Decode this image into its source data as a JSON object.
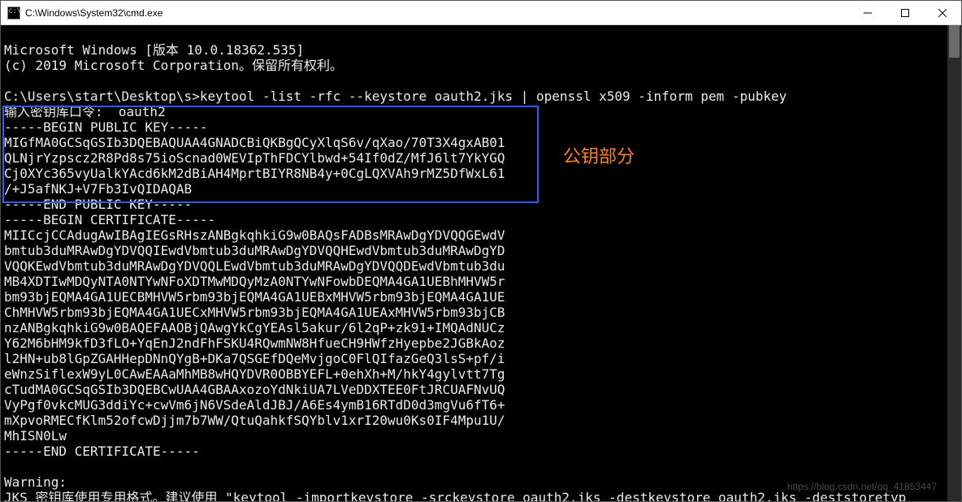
{
  "window": {
    "title": "C:\\Windows\\System32\\cmd.exe"
  },
  "terminal": {
    "header1": "Microsoft Windows [版本 10.0.18362.535]",
    "header2": "(c) 2019 Microsoft Corporation。保留所有权利。",
    "prompt_line": "C:\\Users\\start\\Desktop\\s>keytool -list -rfc --keystore oauth2.jks | openssl x509 -inform pem -pubkey",
    "password_line": "输入密钥库口令:  oauth2",
    "pubkey_begin": "-----BEGIN PUBLIC KEY-----",
    "pubkey_l1": "MIGfMA0GCSqGSIb3DQEBAQUAA4GNADCBiQKBgQCyXlqS6v/qXao/70T3X4gxAB01",
    "pubkey_l2": "QLNjrYzpscz2R8Pd8s75ioScnad0WEVIpThFDCYlbwd+54If0dZ/MfJ6lt7YkYGQ",
    "pubkey_l3": "Cj0XYc365vyUalkYAcd6kM2dBiAH4MprtBIYR8NB4y+0CgLQXVAh9rMZ5DfWxL61",
    "pubkey_l4": "/+J5afNKJ+V7Fb3IvQIDAQAB",
    "pubkey_end": "-----END PUBLIC KEY-----",
    "cert_begin": "-----BEGIN CERTIFICATE-----",
    "cert_l1": "MIICcjCCAdugAwIBAgIEGsRHszANBgkqhkiG9w0BAQsFADBsMRAwDgYDVQQGEwdV",
    "cert_l2": "bmtub3duMRAwDgYDVQQIEwdVbmtub3duMRAwDgYDVQQHEwdVbmtub3duMRAwDgYD",
    "cert_l3": "VQQKEwdVbmtub3duMRAwDgYDVQQLEwdVbmtub3duMRAwDgYDVQQDEwdVbmtub3du",
    "cert_l4": "MB4XDTIwMDQyNTA0NTYwNFoXDTMwMDQyMzA0NTYwNFowbDEQMA4GA1UEBhMHVW5r",
    "cert_l5": "bm93bjEQMA4GA1UECBMHVW5rbm93bjEQMA4GA1UEBxMHVW5rbm93bjEQMA4GA1UE",
    "cert_l6": "ChMHVW5rbm93bjEQMA4GA1UECxMHVW5rbm93bjEQMA4GA1UEAxMHVW5rbm93bjCB",
    "cert_l7": "nzANBgkqhkiG9w0BAQEFAAOBjQAwgYkCgYEAsl5akur/6l2qP+zk91+IMQAdNUCz",
    "cert_l8": "Y62M6bHM9kfD3fLO+YqEnJ2ndFhFSKU4RQwmNW8HfueCH9HWfzHyepbe2JGBkAoz",
    "cert_l9": "l2HN+ub8lGpZGAHHepDNnQYgB+DKa7QSGEfDQeMvjgoC0FlQIfazGeQ3lsS+pf/i",
    "cert_l10": "eWnzSiflexW9yL0CAwEAAaMhMB8wHQYDVR0OBBYEFL+0ehXh+M/hkY4gylvtt7Tg",
    "cert_l11": "cTudMA0GCSqGSIb3DQEBCwUAA4GBAAxozoYdNkiUA7LVeDDXTEE0FtJRCUAFNvUQ",
    "cert_l12": "VyPgf0vkcMUG3ddiYc+cwVm6jN6VSdeAldJBJ/A6Es4ymB16RTdD0d3mgVu6fT6+",
    "cert_l13": "mXpvoRMECfKlm52ofcwDjjm7b7WW/QtuQahkfSQYblv1xrI20wu0Ks0IF4Mpu1U/",
    "cert_l14": "MhISN0Lw",
    "cert_end": "-----END CERTIFICATE-----",
    "warning1": "Warning:",
    "warning2": "JKS 密钥库使用专用格式。建议使用 \"keytool -importkeystore -srckeystore oauth2.jks -destkeystore oauth2.jks -deststoretyp"
  },
  "annotation": {
    "label": "公钥部分"
  },
  "watermark": "https://blog.csdn.net/qq_41853447"
}
